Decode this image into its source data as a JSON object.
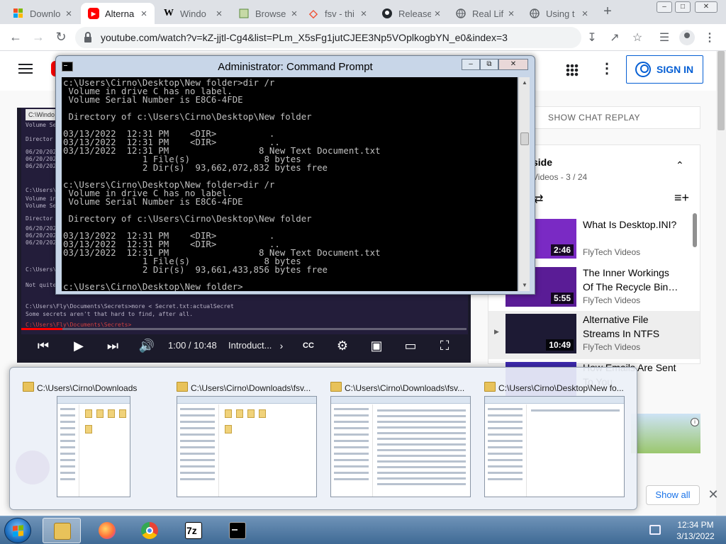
{
  "browser": {
    "tabs": [
      {
        "title": "Downlo",
        "favicon": "windows-logo-icon",
        "color": "#f25022"
      },
      {
        "title": "Alterna",
        "favicon": "youtube-icon",
        "color": "#ff0000",
        "active": true
      },
      {
        "title": "Windo",
        "favicon": "wikipedia-icon",
        "color": "#000000"
      },
      {
        "title": "Browse",
        "favicon": "7zip-icon",
        "color": "#5b8a3c"
      },
      {
        "title": "fsv - thi",
        "favicon": "git-diamond-icon",
        "color": "#f05033"
      },
      {
        "title": "Release",
        "favicon": "github-icon",
        "color": "#24292e"
      },
      {
        "title": "Real Lif",
        "favicon": "globe-icon",
        "color": "#5f6368"
      },
      {
        "title": "Using t",
        "favicon": "globe-icon",
        "color": "#5f6368"
      }
    ],
    "url": "youtube.com/watch?v=kZ-jjtl-Cg4&list=PLm_X5sFg1jutCJEE3Np5VOplkogbYN_e0&index=3"
  },
  "youtube": {
    "sign_in": "SIGN IN",
    "show_chat_replay": "SHOW CHAT REPLAY",
    "player": {
      "time": "1:00 / 10:48",
      "chapter": "Introduct...",
      "progress": 0.093,
      "inner_lines": [
        "C:\\Users\\Fly\\Documents\\Secrets>more < Secret.txt:actualSecret",
        "Some secrets aren't that hard to find, after all.",
        "C:\\Users\\Fly\\Documents\\Secrets>"
      ],
      "inner_partial": [
        "Volume Se",
        "Director",
        "06/20/2020",
        "06/20/2020",
        "06/20/2020",
        "C:\\Users\\F",
        "Volume in",
        "Volume Se",
        "Director",
        "06/20/2020",
        "06/20/2020",
        "06/20/2020",
        "C:\\Users\\F",
        "Not quite"
      ],
      "inner_window_title": "C:\\Windo"
    },
    "playlist": {
      "title": "side",
      "count": "Videos - 3 / 24",
      "items": [
        {
          "title": "What Is Desktop.INI?",
          "channel": "FlyTech Videos",
          "duration": "2:46",
          "thumb": "#7a2ac4"
        },
        {
          "title": "The Inner Workings Of The Recycle Bin…",
          "channel": "FlyTech Videos",
          "duration": "5:55",
          "thumb": "#5a1c96"
        },
        {
          "title": "Alternative File Streams In NTFS",
          "channel": "FlyTech Videos",
          "duration": "10:49",
          "thumb": "#1d1a34",
          "current": true,
          "now_marker": "▶"
        },
        {
          "title": "How Emails Are Sent To You",
          "channel": "",
          "duration": "",
          "thumb": "#3e2ab0"
        }
      ]
    }
  },
  "cmd": {
    "title": "Administrator: Command Prompt",
    "lines": [
      "c:\\Users\\Cirno\\Desktop\\New folder>dir /r",
      " Volume in drive C has no label.",
      " Volume Serial Number is E8C6-4FDE",
      "",
      " Directory of c:\\Users\\Cirno\\Desktop\\New folder",
      "",
      "03/13/2022  12:31 PM    <DIR>          .",
      "03/13/2022  12:31 PM    <DIR>          ..",
      "03/13/2022  12:31 PM                 8 New Text Document.txt",
      "               1 File(s)              8 bytes",
      "               2 Dir(s)  93,662,072,832 bytes free",
      "",
      "c:\\Users\\Cirno\\Desktop\\New folder>dir /r",
      " Volume in drive C has no label.",
      " Volume Serial Number is E8C6-4FDE",
      "",
      " Directory of c:\\Users\\Cirno\\Desktop\\New folder",
      "",
      "03/13/2022  12:31 PM    <DIR>          .",
      "03/13/2022  12:31 PM    <DIR>          ..",
      "03/13/2022  12:31 PM                 8 New Text Document.txt",
      "               1 File(s)              8 bytes",
      "               2 Dir(s)  93,661,433,856 bytes free",
      "",
      "c:\\Users\\Cirno\\Desktop\\New folder>"
    ]
  },
  "explorer_previews": [
    {
      "title": "C:\\Users\\Cirno\\Downloads",
      "layout": "icons"
    },
    {
      "title": "C:\\Users\\Cirno\\Downloads\\fsv...",
      "layout": "icons"
    },
    {
      "title": "C:\\Users\\Cirno\\Downloads\\fsv...",
      "layout": "details"
    },
    {
      "title": "C:\\Users\\Cirno\\Desktop\\New fo...",
      "layout": "details"
    }
  ],
  "downloads_bar": {
    "show_all": "Show all",
    "close_glyph": "✕"
  },
  "taskbar": {
    "apps": [
      {
        "name": "explorer",
        "color": "#e8c25a",
        "active": true
      },
      {
        "name": "firefox",
        "color": "#ff7139"
      },
      {
        "name": "chrome",
        "color": "#34a853"
      },
      {
        "name": "7zip",
        "color": "#000000",
        "label": "7z"
      },
      {
        "name": "cmd",
        "color": "#000000"
      }
    ],
    "time": "12:34 PM",
    "date": "3/13/2022"
  }
}
